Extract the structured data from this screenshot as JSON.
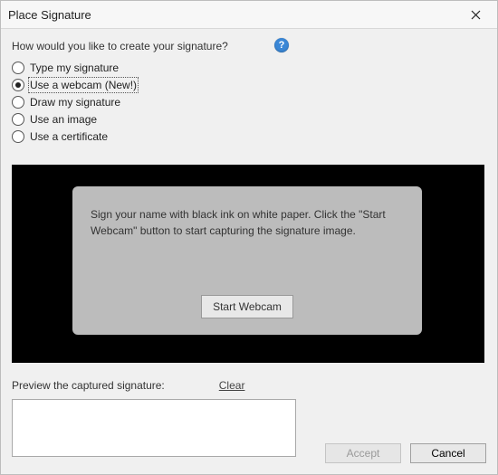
{
  "window": {
    "title": "Place Signature"
  },
  "prompt": "How would you like to create your signature?",
  "options": [
    {
      "label": "Type my signature",
      "selected": false
    },
    {
      "label": "Use a webcam (New!)",
      "selected": true
    },
    {
      "label": "Draw my signature",
      "selected": false
    },
    {
      "label": "Use an image",
      "selected": false
    },
    {
      "label": "Use a certificate",
      "selected": false
    }
  ],
  "webcam": {
    "instructions": "Sign your name with black ink on white paper. Click the \"Start Webcam\" button to start capturing the signature image.",
    "start_button": "Start Webcam"
  },
  "preview": {
    "label": "Preview the captured signature:",
    "clear": "Clear"
  },
  "footer": {
    "accept": "Accept",
    "cancel": "Cancel",
    "accept_enabled": false
  },
  "help_icon_glyph": "?"
}
